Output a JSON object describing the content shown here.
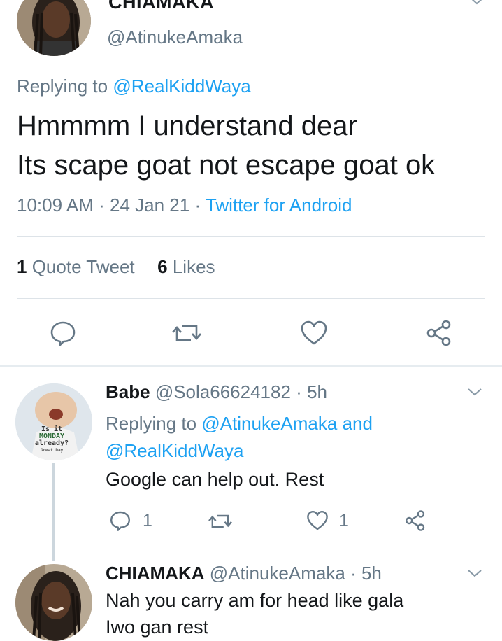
{
  "main_tweet": {
    "display_name": "CHIAMAKA",
    "handle": "@AtinukeAmaka",
    "replying_prefix": "Replying to",
    "replying_to": "@RealKiddWaya",
    "text_line1": "Hmmmm I understand dear",
    "text_line2": "Its scape goat not escape goat ok",
    "time": "10:09 AM",
    "dot1": "·",
    "date": "24 Jan 21",
    "dot2": "·",
    "source": "Twitter for Android",
    "quote_count": "1",
    "quote_label": "Quote Tweet",
    "likes_count": "6",
    "likes_label": "Likes"
  },
  "reply1": {
    "display_name": "Babe",
    "handle": "@Sola66624182",
    "dot": "·",
    "time_ago": "5h",
    "replying_prefix": "Replying to",
    "replying_to_1": "@AtinukeAmaka",
    "and_word": "and",
    "replying_to_2": "@RealKiddWaya",
    "text": "Google can help out. Rest",
    "reply_count": "1",
    "like_count": "1",
    "avatar_caption_1": "Is it",
    "avatar_caption_2": "MONDAY",
    "avatar_caption_3": "already?",
    "avatar_caption_4": "Great Day"
  },
  "reply2": {
    "display_name": "CHIAMAKA",
    "handle": "@AtinukeAmaka",
    "dot": "·",
    "time_ago": "5h",
    "text_line1": "Nah you carry am for head like gala",
    "text_line2": "Iwo gan rest"
  },
  "icons": {
    "reply": "reply-icon",
    "retweet": "retweet-icon",
    "like": "heart-icon",
    "share": "share-icon",
    "menu": "chevron-down-icon"
  },
  "colors": {
    "accent": "#1da1f2",
    "secondary_text": "#657786",
    "separator": "#e6ecf0"
  }
}
